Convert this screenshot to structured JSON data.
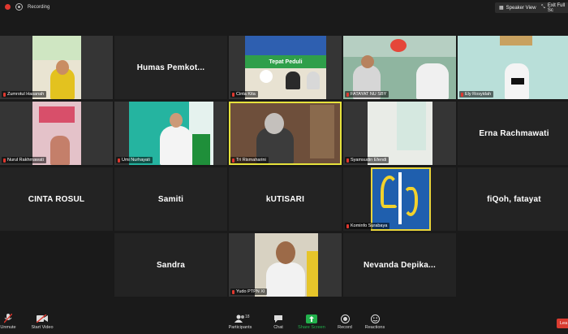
{
  "topbar": {
    "recording_label": "Recording",
    "speaker_view_label": "Speaker View",
    "exit_full_label": "Exit Full Sc"
  },
  "participants": [
    {
      "name": "Zumrotul Hasanah",
      "kind": "video"
    },
    {
      "name": "Humas Pemkot...",
      "kind": "name"
    },
    {
      "name": "Cinta Kita",
      "kind": "video",
      "banner_text": "Tepat Peduli"
    },
    {
      "name": "FATAYAT NU SBY",
      "kind": "video"
    },
    {
      "name": "Ely Rosyidah",
      "kind": "video"
    },
    {
      "name": "Nurul Rakhmawati",
      "kind": "video"
    },
    {
      "name": "Umi Nurhayati",
      "kind": "video"
    },
    {
      "name": "Tri Rismaharini",
      "kind": "video",
      "active": true
    },
    {
      "name": "Syamsudin Efendi",
      "kind": "video"
    },
    {
      "name": "Erna Rachmawati",
      "kind": "name"
    },
    {
      "name": "CINTA ROSUL",
      "kind": "name"
    },
    {
      "name": "Samiti",
      "kind": "name"
    },
    {
      "name": "kUTISARI",
      "kind": "name"
    },
    {
      "name": "Kominfo Surabaya",
      "kind": "video"
    },
    {
      "name": "fiQoh, fatayat",
      "kind": "name"
    },
    {
      "name": "Sandra",
      "kind": "name"
    },
    {
      "name": "Yudo PTPN XI",
      "kind": "video"
    },
    {
      "name": "Nevanda Depika...",
      "kind": "name"
    }
  ],
  "toolbar": {
    "unmute": "Unmute",
    "start_video": "Start Video",
    "participants": "Participants",
    "participants_count": "18",
    "chat": "Chat",
    "share_screen": "Share Screen",
    "record": "Record",
    "reactions": "Reactions",
    "leave": "Lea"
  },
  "colors": {
    "accent_green": "#22b14c",
    "active_speaker": "#e6e23c",
    "mic_muted": "#e0382f",
    "leave": "#d93b30"
  }
}
